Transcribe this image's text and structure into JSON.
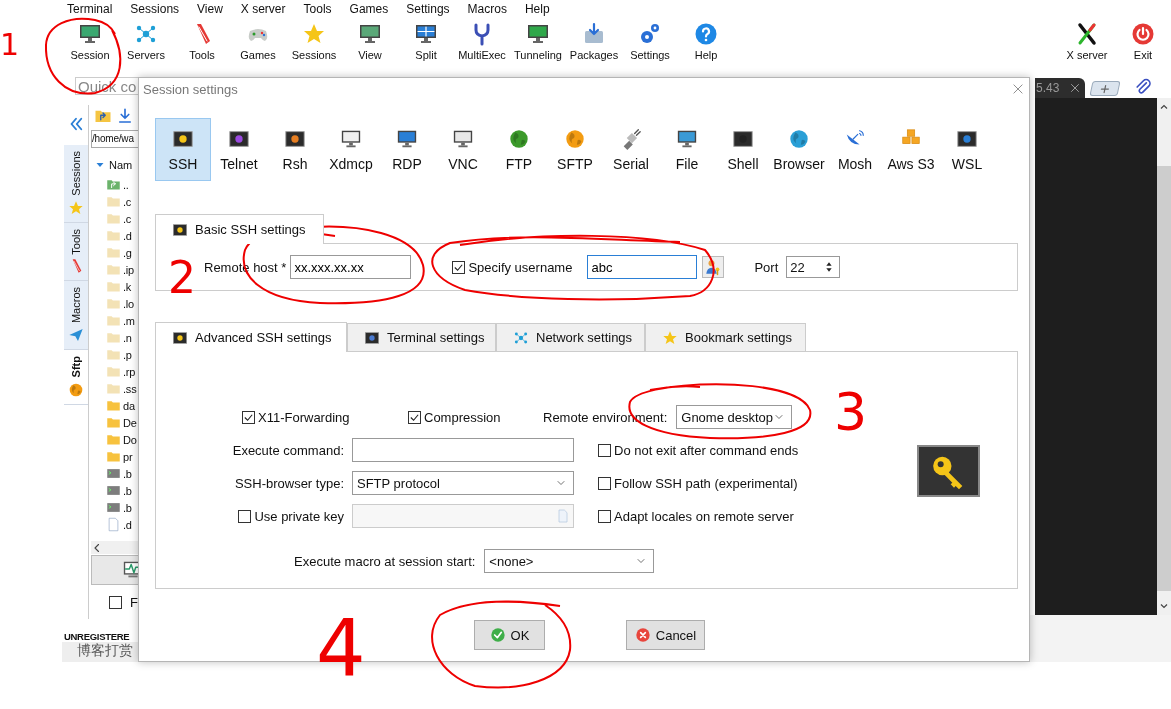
{
  "menu": [
    "Terminal",
    "Sessions",
    "View",
    "X server",
    "Tools",
    "Games",
    "Settings",
    "Macros",
    "Help"
  ],
  "toolbar": [
    "Session",
    "Servers",
    "Tools",
    "Games",
    "Sessions",
    "View",
    "Split",
    "MultiExec",
    "Tunneling",
    "Packages",
    "Settings",
    "Help"
  ],
  "toolbar_right": [
    "X server",
    "Exit"
  ],
  "quick_connect": {
    "placeholder": "Quick co"
  },
  "side_tabs": [
    {
      "label": "Sessions",
      "selected": false
    },
    {
      "label": "Tools",
      "selected": false
    },
    {
      "label": "Macros",
      "selected": false
    },
    {
      "label": "Sftp",
      "selected": true
    }
  ],
  "file_browser": {
    "path": "/home/wa",
    "column": "Nam",
    "entries": [
      {
        "name": "..",
        "kind": "parent"
      },
      {
        "name": ".c",
        "kind": "hidden"
      },
      {
        "name": ".c",
        "kind": "hidden"
      },
      {
        "name": ".d",
        "kind": "hidden"
      },
      {
        "name": ".g",
        "kind": "hidden"
      },
      {
        "name": ".ip",
        "kind": "hidden"
      },
      {
        "name": ".k",
        "kind": "hidden"
      },
      {
        "name": ".lo",
        "kind": "hidden"
      },
      {
        "name": ".m",
        "kind": "hidden"
      },
      {
        "name": ".n",
        "kind": "hidden"
      },
      {
        "name": ".p",
        "kind": "hidden"
      },
      {
        "name": ".rp",
        "kind": "hidden"
      },
      {
        "name": ".ss",
        "kind": "hidden"
      },
      {
        "name": "da",
        "kind": "folder"
      },
      {
        "name": "De",
        "kind": "folder"
      },
      {
        "name": "Do",
        "kind": "folder"
      },
      {
        "name": "pr",
        "kind": "folder"
      },
      {
        "name": ".b",
        "kind": "script"
      },
      {
        "name": ".b",
        "kind": "script"
      },
      {
        "name": ".b",
        "kind": "script"
      },
      {
        "name": ".d",
        "kind": "file"
      }
    ],
    "follow": {
      "label": "F",
      "checked": false
    }
  },
  "status": "UNREGISTERE",
  "footer_link": "博客打赏",
  "terminal_tab": {
    "label": "5.43"
  },
  "dialog": {
    "title": "Session settings",
    "session_types": [
      {
        "label": "SSH",
        "selected": true
      },
      {
        "label": "Telnet",
        "selected": false
      },
      {
        "label": "Rsh",
        "selected": false
      },
      {
        "label": "Xdmcp",
        "selected": false
      },
      {
        "label": "RDP",
        "selected": false
      },
      {
        "label": "VNC",
        "selected": false
      },
      {
        "label": "FTP",
        "selected": false
      },
      {
        "label": "SFTP",
        "selected": false
      },
      {
        "label": "Serial",
        "selected": false
      },
      {
        "label": "File",
        "selected": false
      },
      {
        "label": "Shell",
        "selected": false
      },
      {
        "label": "Browser",
        "selected": false
      },
      {
        "label": "Mosh",
        "selected": false
      },
      {
        "label": "Aws S3",
        "selected": false
      },
      {
        "label": "WSL",
        "selected": false
      }
    ],
    "basic_tab": "Basic SSH settings",
    "remote_host": {
      "label": "Remote host *",
      "value": "xx.xxx.xx.xx"
    },
    "specify_username": {
      "label": "Specify username",
      "checked": true,
      "value": "abc"
    },
    "port": {
      "label": "Port",
      "value": "22"
    },
    "advanced_tabs": [
      {
        "label": "Advanced SSH settings",
        "selected": true
      },
      {
        "label": "Terminal settings",
        "selected": false
      },
      {
        "label": "Network settings",
        "selected": false
      },
      {
        "label": "Bookmark settings",
        "selected": false
      }
    ],
    "x11_forwarding": {
      "label": "X11-Forwarding",
      "checked": true
    },
    "compression": {
      "label": "Compression",
      "checked": true
    },
    "remote_environment": {
      "label": "Remote environment:",
      "value": "Gnome desktop"
    },
    "execute_command": {
      "label": "Execute command:"
    },
    "do_not_exit": {
      "label": "Do not exit after command ends",
      "checked": false
    },
    "ssh_browser_type": {
      "label": "SSH-browser type:",
      "value": "SFTP protocol"
    },
    "follow_ssh_path": {
      "label": "Follow SSH path (experimental)",
      "checked": false
    },
    "use_private_key": {
      "label": "Use private key",
      "checked": false
    },
    "adapt_locales": {
      "label": "Adapt locales on remote server",
      "checked": false
    },
    "execute_macro": {
      "label": "Execute macro at session start:",
      "value": "<none>"
    },
    "buttons": [
      "OK",
      "Cancel"
    ]
  },
  "annotations": [
    "1",
    "2",
    "3",
    "4"
  ]
}
